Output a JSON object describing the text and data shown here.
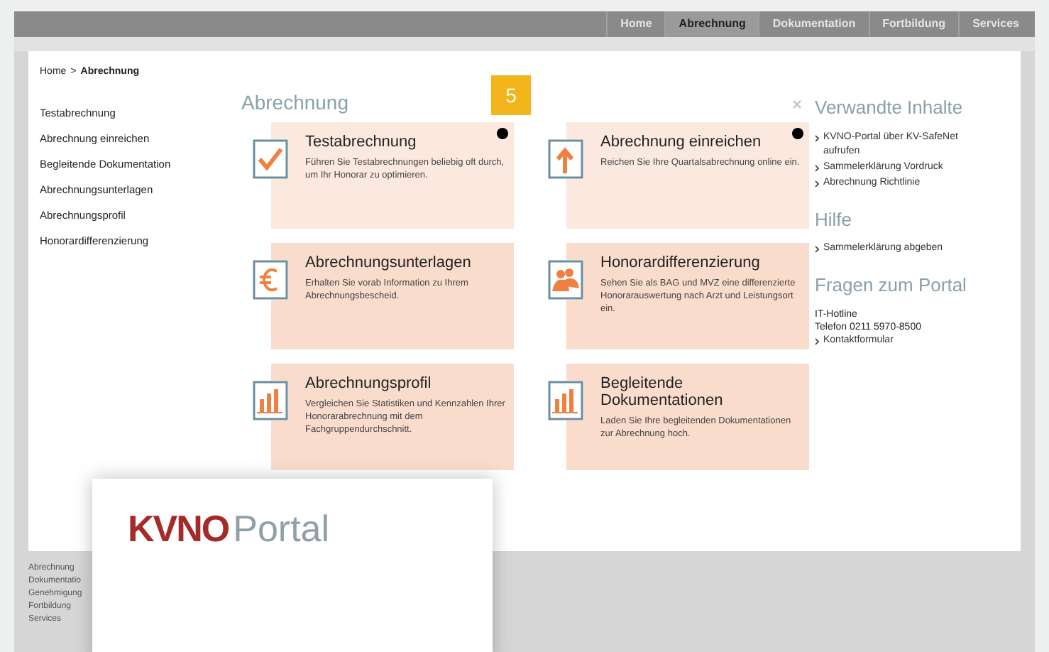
{
  "nav": [
    {
      "label": "Home",
      "selected": false
    },
    {
      "label": "Abrechnung",
      "selected": true
    },
    {
      "label": "Dokumentation",
      "selected": false
    },
    {
      "label": "Fortbildung",
      "selected": false
    },
    {
      "label": "Services",
      "selected": false
    }
  ],
  "breadcrumb": {
    "home": "Home",
    "separator": ">",
    "current": "Abrechnung"
  },
  "sidebar": {
    "items": [
      "Testabrechnung",
      "Abrechnung einreichen",
      "Begleitende Dokumentation",
      "Abrechnungsunterlagen",
      "Abrechnungsprofil",
      "Honorardifferenzierung"
    ]
  },
  "main": {
    "title": "Abrechnung",
    "badge": "5",
    "cards": [
      {
        "kind": "check",
        "title": "Testabrechnung",
        "text": "Führen Sie Testabrechnungen beliebig oft durch, um Ihr Honorar zu optimieren.",
        "info": true
      },
      {
        "kind": "upload",
        "title": "Abrechnung einreichen",
        "text": "Reichen Sie Ihre Quartalsabrechnung online ein.",
        "info": true
      },
      {
        "kind": "euro",
        "title": "Abrechnungsunterlagen",
        "text": "Erhalten Sie vorab Information zu Ihrem Abrechnungsbescheid.",
        "info": false
      },
      {
        "kind": "people",
        "title": "Honorardifferenzierung",
        "text": "Sehen Sie als BAG und MVZ eine differenzierte Honorarauswertung nach Arzt und Leistungsort ein.",
        "info": false
      },
      {
        "kind": "chart",
        "title": "Abrechnungsprofil",
        "text": "Vergleichen Sie Statistiken und Kennzahlen Ihrer Honorarabrechnung mit dem Fachgruppendurchschnitt.",
        "info": false
      },
      {
        "kind": "chart",
        "title": "Begleitende Dokumentationen",
        "text": "Laden Sie Ihre begleitenden Dokumentationen zur Abrechnung hoch.",
        "info": false
      }
    ]
  },
  "right": {
    "sections": [
      {
        "title": "Verwandte Inhalte",
        "items": [
          {
            "kind": "link",
            "text": "KVNO-Portal über KV-SafeNet aufrufen"
          },
          {
            "kind": "link",
            "text": "Sammelerklärung Vordruck"
          },
          {
            "kind": "link",
            "text": "Abrechnung Richtlinie"
          }
        ]
      },
      {
        "title": "Hilfe",
        "items": [
          {
            "kind": "link",
            "text": "Sammelerklärung abgeben"
          }
        ]
      },
      {
        "title": "Fragen zum Portal",
        "items": [
          {
            "kind": "text",
            "text": "IT-Hotline"
          },
          {
            "kind": "text",
            "text": "Telefon 0211 5970-8500"
          },
          {
            "kind": "link",
            "text": "Kontaktformular"
          }
        ]
      }
    ]
  },
  "footer": {
    "links": [
      "Abrechnung",
      "Dokumentatio",
      "Genehmigung",
      "Fortbildung",
      "Services"
    ]
  },
  "overlay": {
    "logo_bold": "KVNO",
    "logo_light": "Portal"
  }
}
